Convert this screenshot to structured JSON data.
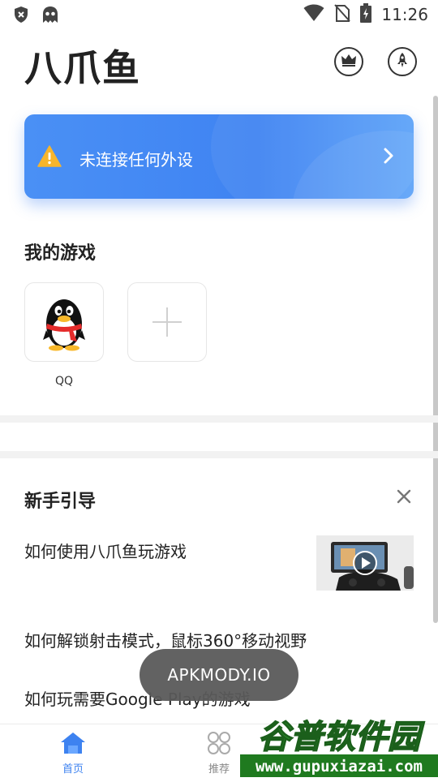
{
  "status_bar": {
    "time": "11:26",
    "icons": [
      "shield-x-icon",
      "ghost-icon",
      "wifi-icon",
      "no-sim-icon",
      "battery-charging-icon"
    ]
  },
  "header": {
    "title": "八爪鱼",
    "actions": [
      "crown-icon",
      "rocket-icon"
    ]
  },
  "banner": {
    "text": "未连接任何外设",
    "icon": "warning-icon",
    "accent": "#3f83f2"
  },
  "my_games": {
    "title": "我的游戏",
    "games": [
      {
        "label": "QQ",
        "icon": "qq-penguin-icon"
      }
    ],
    "add_icon": "plus-icon"
  },
  "guide": {
    "title": "新手引导",
    "items": [
      "如何使用八爪鱼玩游戏",
      "如何解锁射击模式，鼠标360°移动视野",
      "如何玩需要Google Play的游戏"
    ]
  },
  "toast": {
    "text": "APKMODY.IO"
  },
  "bottom_nav": {
    "items": [
      {
        "label": "首页",
        "icon": "home-icon",
        "active": true
      },
      {
        "label": "推荐",
        "icon": "grid-icon",
        "active": false
      }
    ],
    "active_color": "#3d82f0"
  },
  "watermark": {
    "title": "谷普软件园",
    "url": "www.gupuxiazai.com"
  }
}
